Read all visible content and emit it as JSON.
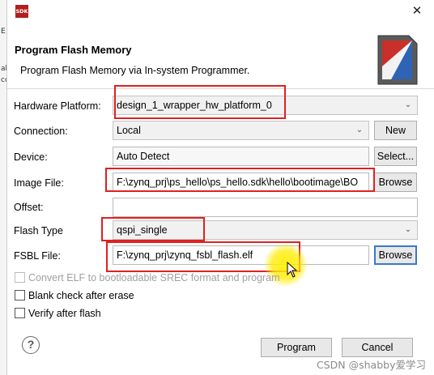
{
  "left_strip": [
    "E",
    "ab",
    "cc"
  ],
  "window": {
    "icon_text": "SDK",
    "close_glyph": "✕"
  },
  "header": {
    "title": "Program Flash Memory",
    "description": "Program Flash Memory via In-system Programmer."
  },
  "form": {
    "hardware_platform": {
      "label": "Hardware Platform:",
      "value": "design_1_wrapper_hw_platform_0"
    },
    "connection": {
      "label": "Connection:",
      "value": "Local",
      "new_button": "New"
    },
    "device": {
      "label": "Device:",
      "value": "Auto Detect",
      "select_button": "Select..."
    },
    "image_file": {
      "label": "Image File:",
      "value": "F:\\zynq_prj\\ps_hello\\ps_hello.sdk\\hello\\bootimage\\BO",
      "browse_button": "Browse"
    },
    "offset": {
      "label": "Offset:",
      "value": ""
    },
    "flash_type": {
      "label": "Flash Type",
      "value": "qspi_single"
    },
    "fsbl_file": {
      "label": "FSBL File:",
      "value": "F:\\zynq_prj\\zynq_fsbl_flash.elf",
      "browse_button": "Browse"
    }
  },
  "options": {
    "convert_elf": {
      "label": "Convert ELF to bootloadable SREC format and program",
      "checked": false,
      "enabled": false
    },
    "blank_check": {
      "label": "Blank check after erase",
      "checked": false,
      "enabled": true
    },
    "verify": {
      "label": "Verify after flash",
      "checked": false,
      "enabled": true
    }
  },
  "footer": {
    "help_glyph": "?",
    "program_button": "Program",
    "cancel_button": "Cancel"
  },
  "watermark": "CSDN @shabby爱学习",
  "colors": {
    "highlight": "#e02020",
    "focus": "#3a78c9",
    "sdk_icon": "#b0201e"
  }
}
